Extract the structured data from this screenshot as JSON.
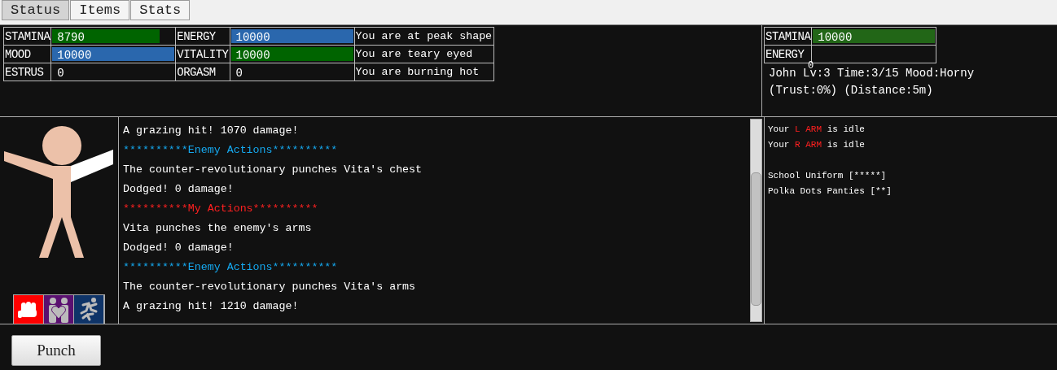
{
  "tabs": [
    {
      "label": "Status",
      "selected": true
    },
    {
      "label": "Items",
      "selected": false
    },
    {
      "label": "Stats",
      "selected": false
    }
  ],
  "stats": [
    [
      {
        "label": "STAMINA",
        "reading": "8790",
        "level": 0.88,
        "color": "#006400"
      },
      {
        "label": "ENERGY",
        "reading": "10000",
        "level": 1,
        "color": "#2a67ad"
      },
      {
        "label": "You are at peak shape"
      }
    ],
    [
      {
        "label": "MOOD",
        "reading": "10000",
        "level": 1,
        "color": "#2a67ad"
      },
      {
        "label": "VITALITY",
        "reading": "10000",
        "level": 1,
        "color": "#006400"
      },
      {
        "label": "You are teary eyed"
      }
    ],
    [
      {
        "label": "ESTRUS",
        "reading": "0"
      },
      {
        "label": "ORGASM",
        "reading": "0"
      },
      {
        "label": "You are burning hot"
      }
    ]
  ],
  "enemy": {
    "stats": [
      {
        "label": "STAMINA",
        "reading": "10000",
        "level": 1,
        "color": "#226617"
      },
      {
        "label": "ENERGY"
      }
    ],
    "info": [
      "John Lv:3 Time:3/15 Mood:Horny",
      "(Trust:0%) (Distance:5m)"
    ],
    "overlay": "0"
  },
  "actions": [
    {
      "kind": "fist",
      "color": "#ff0000"
    },
    {
      "kind": "hug",
      "color": "#5a1070"
    },
    {
      "kind": "run",
      "color": "#0f3468"
    }
  ],
  "log": [
    {
      "kind": "text",
      "text": "A grazing hit! 1070 damage!"
    },
    {
      "kind": "enemy",
      "text": "**********Enemy Actions**********"
    },
    {
      "kind": "text",
      "text": "The counter-revolutionary punches Vita's chest"
    },
    {
      "kind": "text",
      "text": "Dodged! 0 damage!"
    },
    {
      "kind": "mine",
      "text": "**********My Actions**********"
    },
    {
      "kind": "text",
      "text": "Vita punches the enemy's arms"
    },
    {
      "kind": "text",
      "text": "Dodged! 0 damage!"
    },
    {
      "kind": "enemy",
      "text": "**********Enemy Actions**********"
    },
    {
      "kind": "text",
      "text": "The counter-revolutionary punches Vita's arms"
    },
    {
      "kind": "text",
      "text": "A grazing hit! 1210 damage!"
    }
  ],
  "limbs": [
    [
      {
        "text": "Your ",
        "highlight": false
      },
      {
        "text": "L ARM",
        "highlight": true
      },
      {
        "text": " is idle",
        "highlight": false
      }
    ],
    [
      {
        "text": "Your ",
        "highlight": false
      },
      {
        "text": "R ARM",
        "highlight": true
      },
      {
        "text": " is idle",
        "highlight": false
      }
    ]
  ],
  "clothes": [
    "School Uniform [*****]",
    "Polka Dots Panties [**]"
  ],
  "buttons": [
    "Punch"
  ]
}
